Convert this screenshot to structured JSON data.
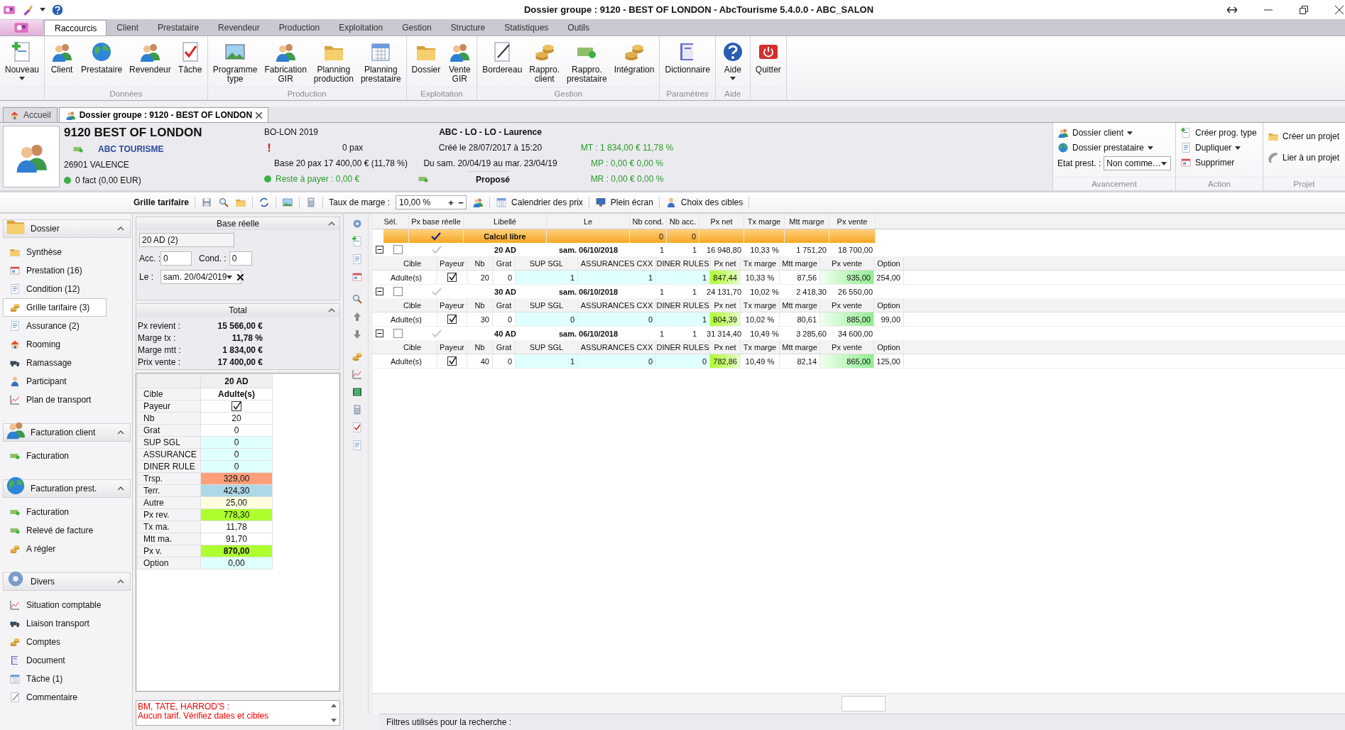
{
  "window": {
    "title": "Dossier groupe : 9120 - BEST OF LONDON - AbcTourisme 5.4.0.0 - ABC_SALON"
  },
  "ribbon": {
    "tabs": [
      {
        "label": "Raccourcis",
        "selected": true
      },
      {
        "label": "Client",
        "selected": false
      },
      {
        "label": "Prestataire",
        "selected": false
      },
      {
        "label": "Revendeur",
        "selected": false
      },
      {
        "label": "Production",
        "selected": false
      },
      {
        "label": "Exploitation",
        "selected": false
      },
      {
        "label": "Gestion",
        "selected": false
      },
      {
        "label": "Structure",
        "selected": false
      },
      {
        "label": "Statistiques",
        "selected": false
      },
      {
        "label": "Outils",
        "selected": false
      }
    ],
    "groups": [
      {
        "buttons": [
          {
            "label": "Nouveau",
            "dropdown": true
          }
        ]
      },
      {
        "label": "Données",
        "buttons": [
          {
            "label": "Client",
            "dropdown": false
          },
          {
            "label": "Prestataire",
            "dropdown": false
          },
          {
            "label": "Revendeur",
            "dropdown": false
          },
          {
            "label": "Tâche",
            "dropdown": false
          }
        ]
      },
      {
        "label": "Production",
        "buttons": [
          {
            "label": "Programme\ntype",
            "dropdown": false
          },
          {
            "label": "Fabrication\nGIR",
            "dropdown": false
          },
          {
            "label": "Planning\nproduction",
            "dropdown": false
          },
          {
            "label": "Planning\nprestataire",
            "dropdown": false
          }
        ]
      },
      {
        "label": "Exploitation",
        "buttons": [
          {
            "label": "Dossier",
            "dropdown": false
          },
          {
            "label": "Vente\nGIR",
            "dropdown": false
          }
        ]
      },
      {
        "label": "Gestion",
        "buttons": [
          {
            "label": "Bordereau",
            "dropdown": false
          },
          {
            "label": "Rappro.\nclient",
            "dropdown": false
          },
          {
            "label": "Rappro.\nprestataire",
            "dropdown": false
          },
          {
            "label": "Intégration",
            "dropdown": false
          }
        ]
      },
      {
        "label": "Paramètres",
        "buttons": [
          {
            "label": "Dictionnaire",
            "dropdown": false
          }
        ]
      },
      {
        "label": "Aide",
        "buttons": [
          {
            "label": "Aide",
            "dropdown": true
          }
        ]
      },
      {
        "buttons": [
          {
            "label": "Quitter",
            "dropdown": false
          }
        ]
      }
    ]
  },
  "doc_tabs": [
    {
      "label": "Accueil",
      "selected": false,
      "closable": false
    },
    {
      "label": "Dossier groupe : 9120 - BEST OF LONDON",
      "selected": true,
      "closable": true
    }
  ],
  "dossier": {
    "name": "9120 BEST OF LONDON",
    "company": "ABC TOURISME",
    "city": "26901 VALENCE",
    "invoices": {
      "text": "0 fact (0,00 EUR)",
      "color": "#3cb043"
    },
    "code": "BO-LON 2019",
    "pax": "0 pax",
    "base": "Base 20 pax 17 400,00 € (11,78 %)",
    "balance": {
      "text": "Reste à payer : 0,00 €",
      "color": "#3cb043"
    },
    "agent": "ABC - LO - LO - Laurence",
    "created": "Créé le 28/07/2017 à 15:20",
    "dates": "Du sam. 20/04/19 au mar. 23/04/19",
    "status": "Proposé",
    "margins": [
      "MT : 1 834,00 € 11,78 %",
      "MP : 0,00 € 0,00 %",
      "MR : 0,00 € 0,00 %"
    ]
  },
  "side_groups": [
    {
      "label": "Avancement",
      "items": [
        {
          "label": "Dossier client",
          "dropdown": true
        },
        {
          "label": "Dossier prestataire",
          "dropdown": true
        }
      ],
      "field": {
        "label": "Etat prest. :",
        "value": "Non comme…"
      }
    },
    {
      "label": "Action",
      "items": [
        {
          "label": "Créer prog. type"
        },
        {
          "label": "Dupliquer",
          "dropdown": true
        },
        {
          "label": "Supprimer"
        }
      ]
    },
    {
      "label": "Projet",
      "items": [
        {
          "label": "Créer un projet"
        },
        {
          "label": "Lier à un projet"
        }
      ]
    }
  ],
  "toolbar": {
    "title": "Grille tarifaire",
    "rate_label": "Taux de marge :",
    "rate_value": "10,00 %",
    "rate_steps": [
      "+",
      "−"
    ],
    "buttons": [
      "Calendrier des prix",
      "Plein écran",
      "Choix des cibles"
    ]
  },
  "nav": [
    {
      "title": "Dossier",
      "expanded": true,
      "items": [
        {
          "label": "Synthèse",
          "selected": false
        },
        {
          "label": "Prestation (16)",
          "selected": false
        },
        {
          "label": "Condition (12)",
          "selected": false
        },
        {
          "label": "Grille tarifaire (3)",
          "selected": true
        },
        {
          "label": "Assurance (2)",
          "selected": false
        },
        {
          "label": "Rooming",
          "selected": false
        },
        {
          "label": "Ramassage",
          "selected": false
        },
        {
          "label": "Participant",
          "selected": false
        },
        {
          "label": "Plan de transport",
          "selected": false
        }
      ]
    },
    {
      "title": "Facturation client",
      "expanded": true,
      "items": [
        {
          "label": "Facturation",
          "selected": false
        }
      ]
    },
    {
      "title": "Facturation prest.",
      "expanded": true,
      "items": [
        {
          "label": "Facturation",
          "selected": false
        },
        {
          "label": "Relevé de facture",
          "selected": false
        },
        {
          "label": "A régler",
          "selected": false
        }
      ]
    },
    {
      "title": "Divers",
      "expanded": true,
      "items": [
        {
          "label": "Situation comptable",
          "selected": false
        },
        {
          "label": "Liaison transport",
          "selected": false
        },
        {
          "label": "Comptes",
          "selected": false
        },
        {
          "label": "Document",
          "selected": false
        },
        {
          "label": "Tâche (1)",
          "selected": false
        },
        {
          "label": "Commentaire",
          "selected": false
        }
      ]
    }
  ],
  "base_reelle": {
    "title": "Base réelle",
    "expanded": true,
    "target": "20 AD (2)",
    "acc_label": "Acc. :",
    "acc": "0",
    "cond_label": "Cond. :",
    "cond": "0",
    "date_label": "Le :",
    "date": "sam. 20/04/2019"
  },
  "total": {
    "title": "Total",
    "expanded": true,
    "rows": [
      {
        "label": "Px revient :",
        "value": "15 566,00 €"
      },
      {
        "label": "Marge tx :",
        "value": "11,78 %"
      },
      {
        "label": "Marge mtt :",
        "value": "1 834,00 €"
      },
      {
        "label": "Prix vente :",
        "value": "17 400,00 €"
      }
    ]
  },
  "detail": {
    "header": "20 AD",
    "rows": [
      {
        "kind": "text",
        "label": "Cible",
        "value": "Adulte(s)",
        "bold": true
      },
      {
        "kind": "check",
        "label": "Payeur",
        "checked": true
      },
      {
        "kind": "text",
        "label": "Nb",
        "value": "20",
        "bold": false
      },
      {
        "kind": "text",
        "label": "Grat",
        "value": "0",
        "bold": false
      },
      {
        "kind": "text",
        "label": "SUP SGL",
        "value": "0",
        "bold": false,
        "color": "#e0ffff"
      },
      {
        "kind": "text",
        "label": "ASSURANCE",
        "value": "0",
        "bold": false,
        "color": "#e0ffff"
      },
      {
        "kind": "text",
        "label": "DINER RULE",
        "value": "0",
        "bold": false,
        "color": "#e0ffff"
      },
      {
        "kind": "text",
        "label": "Trsp.",
        "value": "329,00",
        "bold": false,
        "color": "#ffa07a"
      },
      {
        "kind": "text",
        "label": "Terr.",
        "value": "424,30",
        "bold": false,
        "color": "#add8e6"
      },
      {
        "kind": "text",
        "label": "Autre",
        "value": "25,00",
        "bold": false,
        "color": "#ffffe0"
      },
      {
        "kind": "text",
        "label": "Px rev.",
        "value": "778,30",
        "bold": false,
        "color": "#adff2f"
      },
      {
        "kind": "text",
        "label": "Tx ma.",
        "value": "11,78",
        "bold": false
      },
      {
        "kind": "text",
        "label": "Mtt ma.",
        "value": "91,70",
        "bold": false
      },
      {
        "kind": "text",
        "label": "Px v.",
        "value": "870,00",
        "bold": true,
        "color": "#adff2f"
      },
      {
        "kind": "text",
        "label": "Option",
        "value": "0,00",
        "bold": false,
        "color": "#e0ffff"
      }
    ]
  },
  "message": {
    "lines": [
      "BM, TATE, HARROD'S :",
      "Aucun tarif. Vérifiez dates et cibles"
    ]
  },
  "grid": {
    "columns": [
      "Sél.",
      "Px base réelle",
      "Libellé",
      "Le",
      "Nb cond.",
      "Nb acc.",
      "Px net",
      "Tx marge",
      "Mtt marge",
      "Px vente"
    ],
    "summary": {
      "real_base": true,
      "label": "Calcul libre",
      "nb_cond": "0",
      "nb_acc": "0"
    },
    "groups": [
      {
        "expanded": true,
        "selected": false,
        "real_base": false,
        "label": "20 AD",
        "date": "sam. 06/10/2018",
        "nb_cond": "1",
        "nb_acc": "1",
        "px_net": "16 948,80",
        "tx_marge": "10,33 %",
        "mtt_marge": "1 751,20",
        "px_vente": "18 700,00",
        "columns": [
          "Cible",
          "Payeur",
          "Nb",
          "Grat",
          "SUP SGL",
          "ASSURANCES CXX",
          "DINER RULES",
          "Px net",
          "Tx marge",
          "Mtt marge",
          "Px vente",
          "Option"
        ],
        "rows": [
          {
            "target": "Adulte(s)",
            "payer": true,
            "nb": "20",
            "grat": "0",
            "sup_sgl": "1",
            "assurances": "1",
            "diner": "1",
            "px_net": "847,44",
            "tx_marge": "10,33 %",
            "mtt_marge": "87,56",
            "px_vente": "935,00",
            "option": "254,00"
          }
        ]
      },
      {
        "expanded": true,
        "selected": false,
        "real_base": false,
        "label": "30 AD",
        "date": "sam. 06/10/2018",
        "nb_cond": "1",
        "nb_acc": "1",
        "px_net": "24 131,70",
        "tx_marge": "10,02 %",
        "mtt_marge": "2 418,30",
        "px_vente": "26 550,00",
        "columns": [
          "Cible",
          "Payeur",
          "Nb",
          "Grat",
          "SUP SGL",
          "ASSURANCES CXX",
          "DINER RULES",
          "Px net",
          "Tx marge",
          "Mtt marge",
          "Px vente",
          "Option"
        ],
        "rows": [
          {
            "target": "Adulte(s)",
            "payer": true,
            "nb": "30",
            "grat": "0",
            "sup_sgl": "0",
            "assurances": "0",
            "diner": "1",
            "px_net": "804,39",
            "tx_marge": "10,02 %",
            "mtt_marge": "80,61",
            "px_vente": "885,00",
            "option": "99,00"
          }
        ]
      },
      {
        "expanded": true,
        "selected": false,
        "real_base": false,
        "label": "40 AD",
        "date": "sam. 06/10/2018",
        "nb_cond": "1",
        "nb_acc": "1",
        "px_net": "31 314,40",
        "tx_marge": "10,49 %",
        "mtt_marge": "3 285,60",
        "px_vente": "34 600,00",
        "columns": [
          "Cible",
          "Payeur",
          "Nb",
          "Grat",
          "SUP SGL",
          "ASSURANCES CXX",
          "DINER RULES",
          "Px net",
          "Tx marge",
          "Mtt marge",
          "Px vente",
          "Option"
        ],
        "rows": [
          {
            "target": "Adulte(s)",
            "payer": true,
            "nb": "40",
            "grat": "0",
            "sup_sgl": "1",
            "assurances": "0",
            "diner": "0",
            "px_net": "782,86",
            "tx_marge": "10,49 %",
            "mtt_marge": "82,14",
            "px_vente": "865,00",
            "option": "125,00"
          }
        ]
      }
    ]
  },
  "status_bar": {
    "text": "Filtres utilisés pour la recherche :"
  }
}
